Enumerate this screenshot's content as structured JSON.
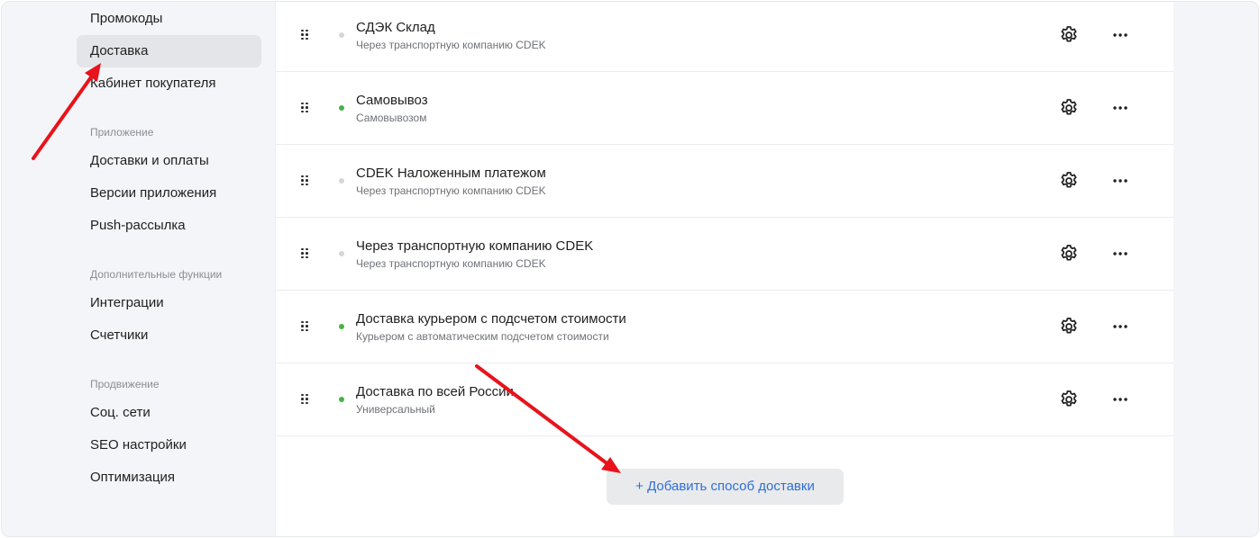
{
  "sidebar": {
    "top_items": [
      "Промокоды",
      "Доставка",
      "Кабинет покупателя"
    ],
    "active_index": 1,
    "groups": [
      {
        "title": "Приложение",
        "items": [
          "Доставки и оплаты",
          "Версии приложения",
          "Push-рассылка"
        ]
      },
      {
        "title": "Дополнительные функции",
        "items": [
          "Интеграции",
          "Счетчики"
        ]
      },
      {
        "title": "Продвижение",
        "items": [
          "Соц. сети",
          "SEO настройки",
          "Оптимизация"
        ]
      }
    ]
  },
  "delivery_methods": [
    {
      "title": "СДЭК Склад",
      "subtitle": "Через транспортную компанию CDEK",
      "active": false
    },
    {
      "title": "Самовывоз",
      "subtitle": "Самовывозом",
      "active": true
    },
    {
      "title": "CDEK Наложенным платежом",
      "subtitle": "Через транспортную компанию CDEK",
      "active": false
    },
    {
      "title": "Через транспортную компанию CDEK",
      "subtitle": "Через транспортную компанию CDEK",
      "active": false
    },
    {
      "title": "Доставка курьером с подсчетом стоимости",
      "subtitle": "Курьером с автоматическим подсчетом стоимости",
      "active": true
    },
    {
      "title": "Доставка по всей России",
      "subtitle": "Универсальный",
      "active": true
    }
  ],
  "add_button_label": "+ Добавить способ доставки",
  "icons": {
    "drag": "drag-handle-icon",
    "settings": "gear-icon",
    "more": "more-dots-icon"
  },
  "colors": {
    "active_dot": "#45b345",
    "inactive_dot": "#d4d6da",
    "link": "#2f6fd8",
    "annotation_arrow": "#e8131b"
  }
}
